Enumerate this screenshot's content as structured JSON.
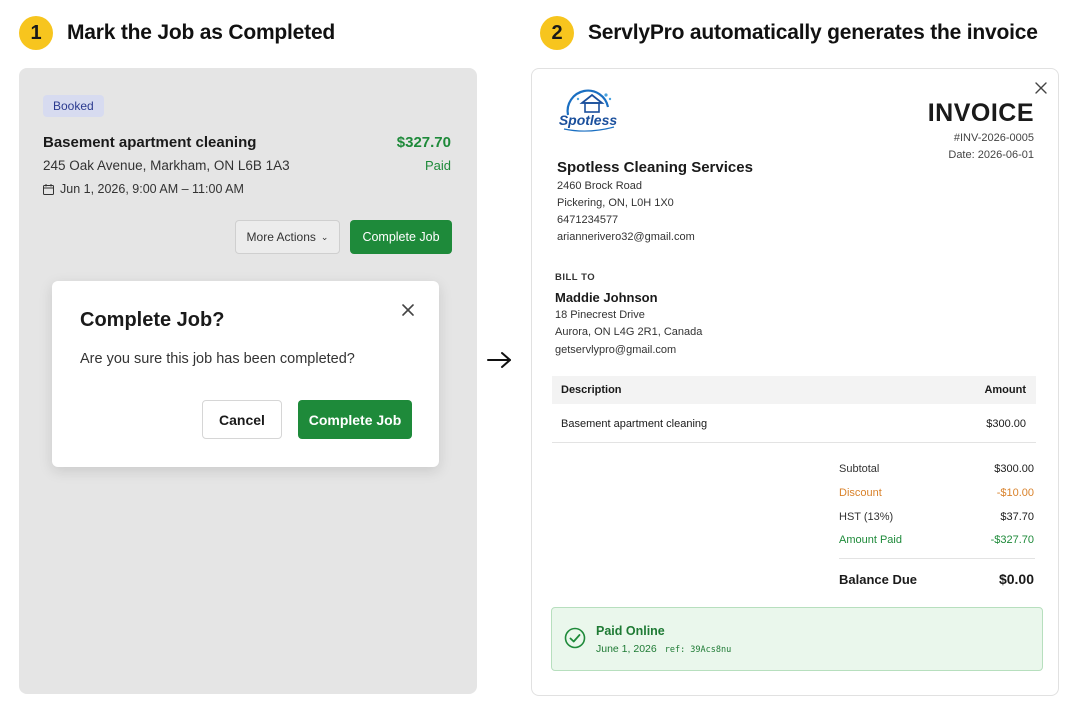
{
  "steps": [
    {
      "number": "1",
      "title": "Mark the Job as Completed"
    },
    {
      "number": "2",
      "title": "ServlyPro automatically generates the invoice"
    }
  ],
  "job_card": {
    "status_badge": "Booked",
    "title": "Basement apartment cleaning",
    "price": "$327.70",
    "address": "245 Oak Avenue, Markham, ON L6B 1A3",
    "payment_status": "Paid",
    "schedule": "Jun 1, 2026, 9:00 AM – 11:00 AM",
    "more_actions_label": "More Actions",
    "complete_job_label": "Complete Job"
  },
  "dialog": {
    "title": "Complete Job?",
    "message": "Are you sure this job has been completed?",
    "cancel_label": "Cancel",
    "confirm_label": "Complete Job"
  },
  "invoice": {
    "logo_text": "Spotless",
    "heading": "INVOICE",
    "number": "#INV-2026-0005",
    "date": "Date: 2026-06-01",
    "business": {
      "name": "Spotless Cleaning Services",
      "address1": "2460 Brock Road",
      "address2": "Pickering, ON, L0H 1X0",
      "phone": "6471234577",
      "email": "ariannerivero32@gmail.com"
    },
    "bill_to": {
      "label": "BILL TO",
      "name": "Maddie Johnson",
      "address1": "18 Pinecrest Drive",
      "address2": "Aurora, ON L4G 2R1, Canada",
      "email": "getservlypro@gmail.com"
    },
    "table": {
      "col_description": "Description",
      "col_amount": "Amount",
      "rows": [
        {
          "description": "Basement apartment cleaning",
          "amount": "$300.00"
        }
      ]
    },
    "totals": {
      "subtotal_label": "Subtotal",
      "subtotal": "$300.00",
      "discount_label": "Discount",
      "discount": "-$10.00",
      "tax_label": "HST (13%)",
      "tax": "$37.70",
      "paid_label": "Amount Paid",
      "paid": "-$327.70",
      "balance_label": "Balance Due",
      "balance": "$0.00"
    },
    "payment": {
      "title": "Paid Online",
      "date": "June 1, 2026",
      "ref": "ref: 39Acs8nu"
    }
  },
  "colors": {
    "accent_yellow": "#f7c51e",
    "green": "#1e8a3a",
    "discount_orange": "#d9822b",
    "badge_bg": "#d7dbf0"
  },
  "icons": [
    "calendar-icon",
    "chevron-down-icon",
    "close-icon",
    "arrow-right-icon",
    "check-circle-icon",
    "spotless-logo"
  ]
}
